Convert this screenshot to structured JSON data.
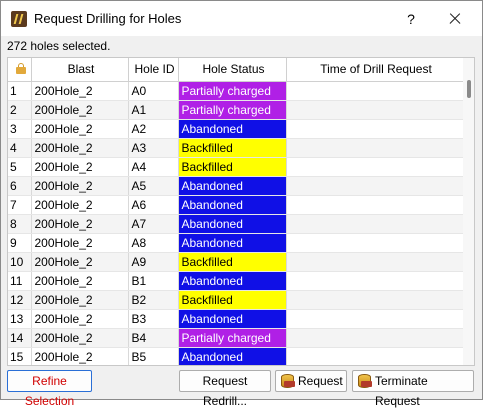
{
  "window": {
    "title": "Request Drilling for Holes",
    "help_label": "?"
  },
  "selection_info": "272 holes selected.",
  "table": {
    "columns": [
      "",
      "Blast",
      "Hole ID",
      "Hole Status",
      "Time of Drill Request"
    ],
    "lock_icon": "lock-icon",
    "rows": [
      {
        "n": "1",
        "blast": "200Hole_2",
        "hole_id": "A0",
        "status": "Partially charged",
        "time": ""
      },
      {
        "n": "2",
        "blast": "200Hole_2",
        "hole_id": "A1",
        "status": "Partially charged",
        "time": ""
      },
      {
        "n": "3",
        "blast": "200Hole_2",
        "hole_id": "A2",
        "status": "Abandoned",
        "time": ""
      },
      {
        "n": "4",
        "blast": "200Hole_2",
        "hole_id": "A3",
        "status": "Backfilled",
        "time": ""
      },
      {
        "n": "5",
        "blast": "200Hole_2",
        "hole_id": "A4",
        "status": "Backfilled",
        "time": ""
      },
      {
        "n": "6",
        "blast": "200Hole_2",
        "hole_id": "A5",
        "status": "Abandoned",
        "time": ""
      },
      {
        "n": "7",
        "blast": "200Hole_2",
        "hole_id": "A6",
        "status": "Abandoned",
        "time": ""
      },
      {
        "n": "8",
        "blast": "200Hole_2",
        "hole_id": "A7",
        "status": "Abandoned",
        "time": ""
      },
      {
        "n": "9",
        "blast": "200Hole_2",
        "hole_id": "A8",
        "status": "Abandoned",
        "time": ""
      },
      {
        "n": "10",
        "blast": "200Hole_2",
        "hole_id": "A9",
        "status": "Backfilled",
        "time": ""
      },
      {
        "n": "11",
        "blast": "200Hole_2",
        "hole_id": "B1",
        "status": "Abandoned",
        "time": ""
      },
      {
        "n": "12",
        "blast": "200Hole_2",
        "hole_id": "B2",
        "status": "Backfilled",
        "time": ""
      },
      {
        "n": "13",
        "blast": "200Hole_2",
        "hole_id": "B3",
        "status": "Abandoned",
        "time": ""
      },
      {
        "n": "14",
        "blast": "200Hole_2",
        "hole_id": "B4",
        "status": "Partially charged",
        "time": ""
      },
      {
        "n": "15",
        "blast": "200Hole_2",
        "hole_id": "B5",
        "status": "Abandoned",
        "time": ""
      }
    ]
  },
  "status_colors": {
    "Partially charged": "#b020e6",
    "Abandoned": "#1010e6",
    "Backfilled": "#ffff00"
  },
  "buttons": {
    "refine": "Refine Selection",
    "redrill": "Request Redrill...",
    "request": "Request",
    "terminate": "Terminate Request"
  }
}
